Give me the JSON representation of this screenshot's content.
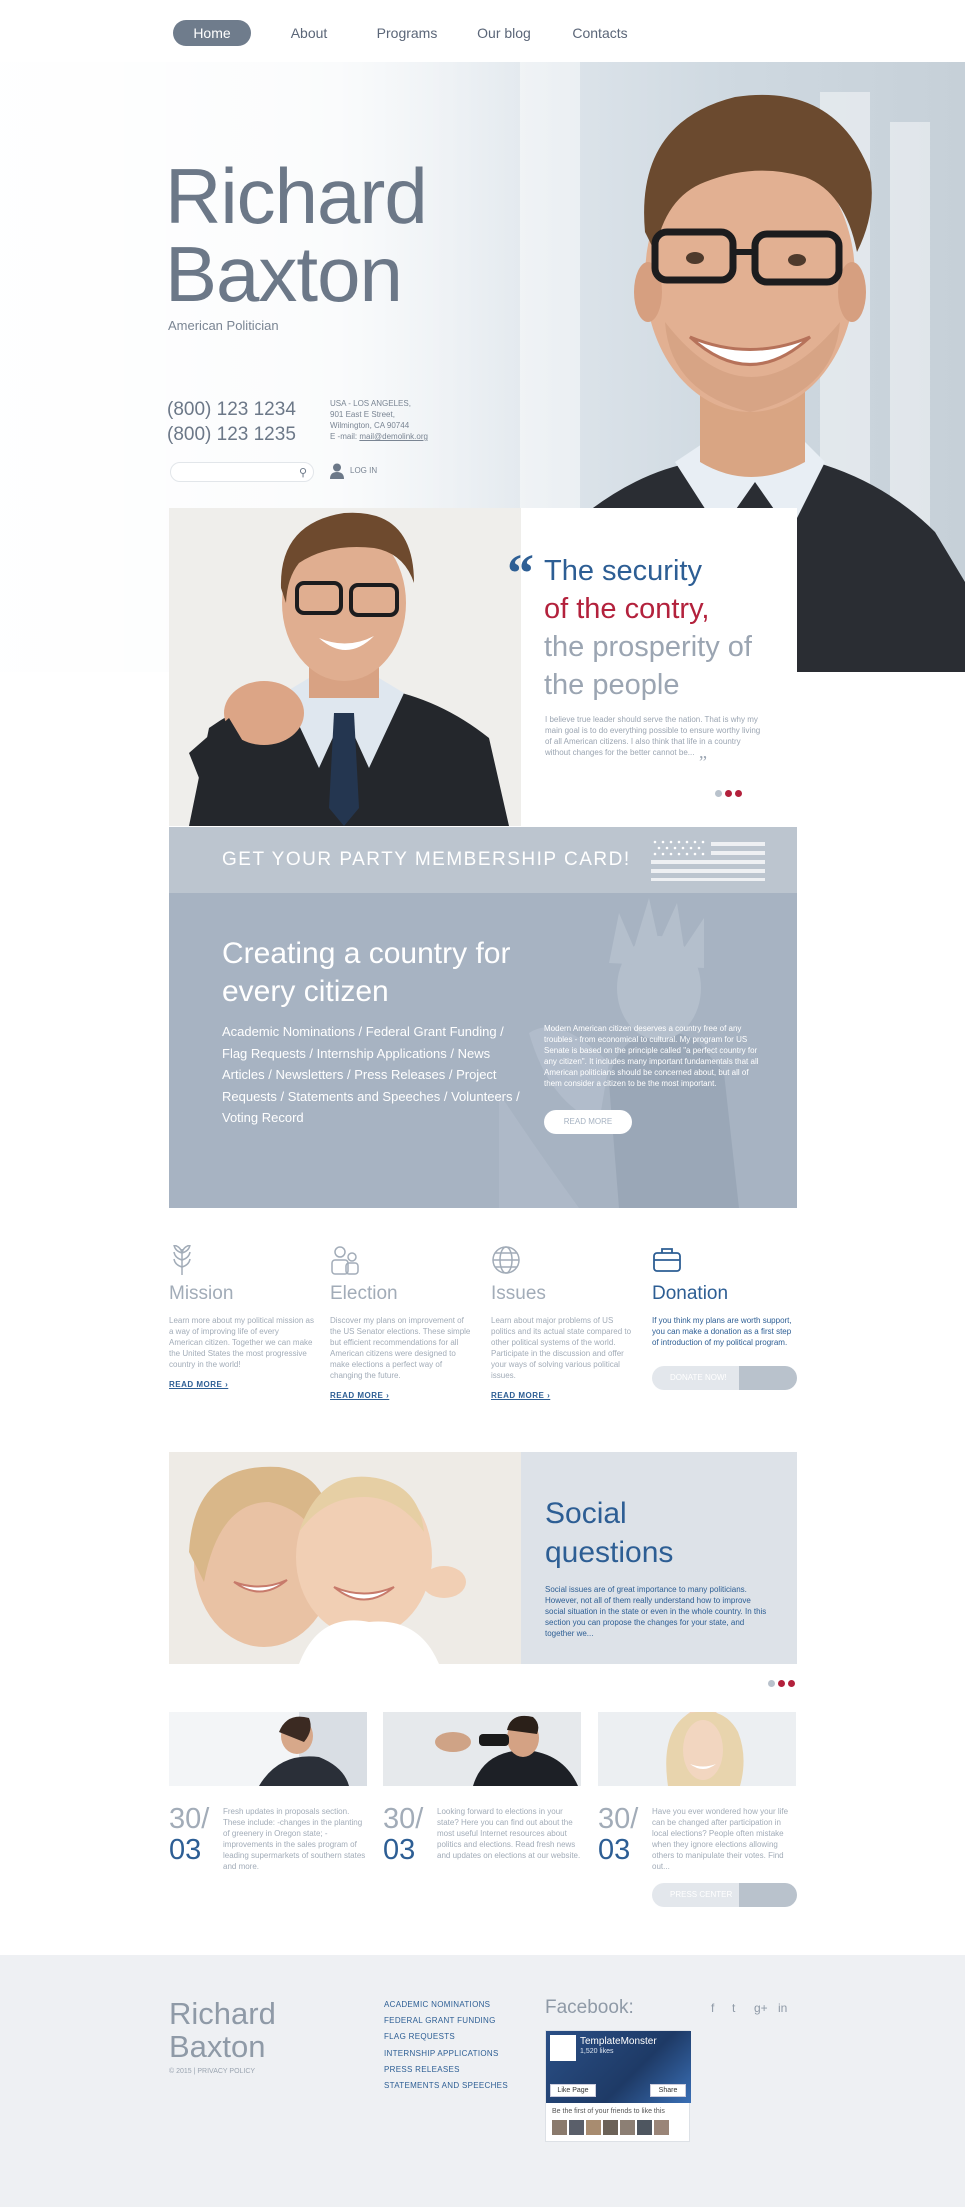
{
  "nav": {
    "items": [
      {
        "label": "Home",
        "active": true
      },
      {
        "label": "About"
      },
      {
        "label": "Programs"
      },
      {
        "label": "Our blog"
      },
      {
        "label": "Contacts"
      }
    ]
  },
  "hero": {
    "name_line1": "Richard",
    "name_line2": "Baxton",
    "subtitle": "American Politician",
    "phone1": "(800) 123 1234",
    "phone2": "(800) 123 1235",
    "address": [
      "USA - LOS ANGELES,",
      "901 East E Street,",
      "Wilmington, CA 90744"
    ],
    "email_prefix": "E -mail: ",
    "email": "mail@demolink.org",
    "search_placeholder": "",
    "login_label": "LOG IN"
  },
  "quote": {
    "line1": "The security",
    "line2": "of  the contry,",
    "line3": "the prosperity of the people",
    "text": "I believe true leader should serve the nation. That is why my main goal is to do everything possible to ensure worthy living of all American citizens. I also think that life in a country without changes for the better cannot be...",
    "open_mark": "“",
    "close_mark": "”"
  },
  "membership": {
    "title": "GET YOUR PARTY MEMBERSHIP CARD!"
  },
  "creating": {
    "title": "Creating a country for every citizen",
    "links": "Academic Nominations / Federal Grant Funding / Flag Requests / Internship Applications / News Articles / Newsletters / Press Releases / Project Requests / Statements and Speeches / Volunteers / Voting Record",
    "text": "Modern American citizen deserves a country free of any troubles - from economical to cultural. My program for US Senate is based on the principle called \"a perfect country for any citizen\". It includes many important fundamentals that all American politicians should be concerned about, but all of them consider a citizen to be the most important.",
    "button": "READ MORE"
  },
  "features": [
    {
      "title": "Mission",
      "icon": "wheat-icon",
      "text": "Learn more about my political mission as a way of improving life of every American citizen. Together we can make the United States the most progressive country in the world!",
      "link": "READ MORE ›"
    },
    {
      "title": "Election",
      "icon": "people-icon",
      "text": "Discover my plans on improvement of the US Senator elections. These simple but efficient recommendations for all American citizens were designed to make elections a perfect way of changing the future.",
      "link": "READ MORE ›"
    },
    {
      "title": "Issues",
      "icon": "globe-icon",
      "text": "Learn about major problems of US politics and its actual state compared to other political systems of the world. Participate in the discussion and offer your ways of solving various political issues.",
      "link": "READ MORE ›"
    },
    {
      "title": "Donation",
      "icon": "briefcase-icon",
      "text": "If you think my plans are worth support, you can make a donation as a first step of introduction of my political program.",
      "button": "DONATE NOW!"
    }
  ],
  "social": {
    "title": "Social questions",
    "text": "Social issues are of great importance to many politicians. However, not all of them really understand how to improve social situation in the state or even in the whole country. In this section you can propose the changes for your state, and together we..."
  },
  "news": [
    {
      "day": "30/",
      "month": "03",
      "text": "Fresh updates in proposals section. These include: -changes in the planting of greenery in Oregon state; -improvements in the sales program of leading supermarkets of southern states and more."
    },
    {
      "day": "30/",
      "month": "03",
      "text": "Looking forward to elections in your state? Here you can find out about the most useful Internet resources about politics and elections. Read fresh news and updates on elections at our website."
    },
    {
      "day": "30/",
      "month": "03",
      "text": "Have you ever wondered how your life can be changed after participation in local elections? People often mistake when they ignore elections allowing others to manipulate their votes. Find out..."
    }
  ],
  "press_button": "PRESS CENTER",
  "footer": {
    "name_line1": "Richard",
    "name_line2": "Baxton",
    "copyright": "© 2015 | PRIVACY POLICY",
    "links": [
      "ACADEMIC NOMINATIONS",
      "FEDERAL GRANT FUNDING",
      "FLAG REQUESTS",
      "INTERNSHIP APPLICATIONS",
      "PRESS RELEASES",
      "STATEMENTS AND SPEECHES"
    ],
    "facebook_title": "Facebook:",
    "social_icons": [
      "f",
      "t",
      "g+",
      "in"
    ],
    "fb_page_name": "TemplateMonster",
    "fb_likes": "1,520 likes",
    "fb_like_btn": "Like Page",
    "fb_share_btn": "Share",
    "fb_friends": "Be the first of your friends to like this"
  },
  "colors": {
    "accent_blue": "#2d5e94",
    "accent_red": "#b3213c",
    "gray": "#6c7888"
  }
}
